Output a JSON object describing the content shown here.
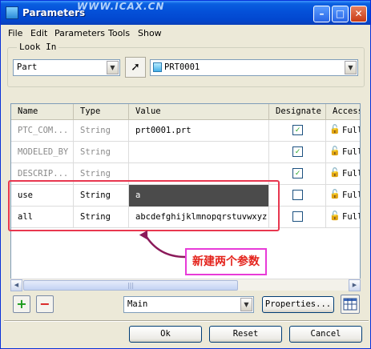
{
  "window": {
    "title": "Parameters",
    "watermark": "WWW.ICAX.CN",
    "minimize_glyph": "–",
    "maximize_glyph": "□",
    "close_glyph": "✕"
  },
  "menu": [
    "File",
    "Edit",
    "Parameters",
    "Tools",
    "Show"
  ],
  "look_in": {
    "label": "Look In",
    "type_value": "Part",
    "object_value": "PRT0001"
  },
  "table": {
    "columns": [
      "Name",
      "Type",
      "Value",
      "Designate",
      "Access"
    ],
    "rows": [
      {
        "name": "PTC_COM...",
        "type": "String",
        "value": "prt0001.prt",
        "designate": true,
        "access": "Full"
      },
      {
        "name": "MODELED_BY",
        "type": "String",
        "value": "",
        "designate": true,
        "access": "Full"
      },
      {
        "name": "DESCRIP...",
        "type": "String",
        "value": "",
        "designate": true,
        "access": "Full"
      },
      {
        "name": "use",
        "type": "String",
        "value": "a",
        "designate": false,
        "access": "Full"
      },
      {
        "name": "all",
        "type": "String",
        "value": "abcdefghijklmnopqrstuvwxyz",
        "designate": false,
        "access": "Full"
      }
    ]
  },
  "annotation": {
    "callout_text": "新建两个参数",
    "box_color": "#e8374f",
    "callout_border_color": "#e83bd8",
    "callout_text_color": "#e4231c",
    "arrow_color": "#8b1a5a"
  },
  "bottom": {
    "add_glyph": "+",
    "remove_glyph": "−",
    "filter_value": "Main",
    "properties_label": "Properties..."
  },
  "dialog_buttons": {
    "ok": "Ok",
    "reset": "Reset",
    "cancel": "Cancel"
  },
  "colors": {
    "titlebar": "#0450d8",
    "selection": "#4b4b4b",
    "add_icon": "#1a9a1a",
    "remove_icon": "#d81a1a"
  }
}
